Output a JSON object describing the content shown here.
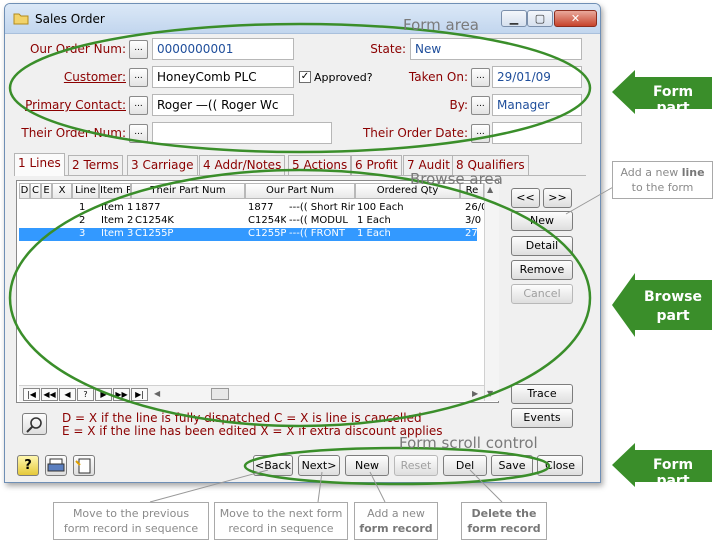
{
  "window": {
    "title": "Sales Order",
    "btn_min": "▁",
    "btn_max": "▢",
    "btn_close": "✕"
  },
  "form": {
    "order_num_label": "Our Order Num:",
    "order_num": "0000000001",
    "state_label": "State:",
    "state": "New",
    "customer_label": "Customer:",
    "customer": "HoneyComb PLC",
    "approved_label": "Approved?",
    "taken_on_label": "Taken On:",
    "taken_on": "29/01/09",
    "primary_contact_label": "Primary Contact:",
    "primary_contact": "Roger     —(( Roger Wc",
    "by_label": "By:",
    "by": "Manager",
    "their_order_num_label": "Their Order Num:",
    "their_order_num": "",
    "their_order_date_label": "Their Order Date:",
    "their_order_date": "",
    "ellipsis": "..."
  },
  "tabs": [
    {
      "label": "1 Lines"
    },
    {
      "label": "2 Terms"
    },
    {
      "label": "3 Carriage"
    },
    {
      "label": "4 Addr/Notes"
    },
    {
      "label": "5 Actions"
    },
    {
      "label": "6 Profit"
    },
    {
      "label": "7 Audit"
    },
    {
      "label": "8 Qualifiers"
    }
  ],
  "grid": {
    "headers": [
      "D",
      "C",
      "E",
      "X",
      "Line",
      "Item Ref",
      "Their Part Num",
      "Our Part Num",
      "Ordered Qty",
      "Re"
    ],
    "rows": [
      {
        "line": "1",
        "item": "Item 1",
        "their": "1877",
        "our": "1877",
        "desc": "---(( Short Rin",
        "qty": "100 Each",
        "re": "26/0"
      },
      {
        "line": "2",
        "item": "Item 2",
        "their": "C1254K",
        "our": "C1254K",
        "desc": "---(( MODUL",
        "qty": "1 Each",
        "re": "3/0"
      },
      {
        "line": "3",
        "item": "Item 3",
        "their": "C1255P",
        "our": "C1255P",
        "desc": "---(( FRONT",
        "qty": "1 Each",
        "re": "27/0"
      }
    ],
    "nav": [
      "|◀",
      "◀◀",
      "◀",
      "?",
      "▶",
      "▶▶",
      "▶|"
    ]
  },
  "side_buttons": {
    "prev": "<<",
    "next": ">>",
    "new": "New",
    "detail": "Detail",
    "remove": "Remove",
    "cancel": "Cancel",
    "trace": "Trace",
    "events": "Events"
  },
  "legend": {
    "line1": "D = X if the line is fully dispatched     C = X is line is cancelled",
    "line2": "E = X if the line has been edited     X = X if extra discount applies"
  },
  "bottom_buttons": {
    "back": "<Back",
    "next": "Next>",
    "new": "New",
    "reset": "Reset",
    "del": "Del",
    "save": "Save",
    "close": "Close"
  },
  "annotations": {
    "form_area": "Form area",
    "browse_area": "Browse area",
    "form_scroll_control": "Form scroll control",
    "form_part_top": "Form part",
    "browse_part_1": "Browse",
    "browse_part_2": "part",
    "form_part_bottom": "Form part",
    "callout_new_line_1": "Add a new",
    "callout_new_line_bold": "line",
    "callout_new_line_2": "to the form",
    "callout_prev_1": "Move to the previous",
    "callout_prev_2": "form record in sequence",
    "callout_next_1": "Move to the next form",
    "callout_next_2": "record in sequence",
    "callout_new_1": "Add a new",
    "callout_new_2": "form record",
    "callout_del_1": "Delete the",
    "callout_del_2": "form record"
  },
  "colors": {
    "accent_green": "#3a8e2a",
    "label_red": "#8b0000",
    "selection": "#3399ff"
  }
}
